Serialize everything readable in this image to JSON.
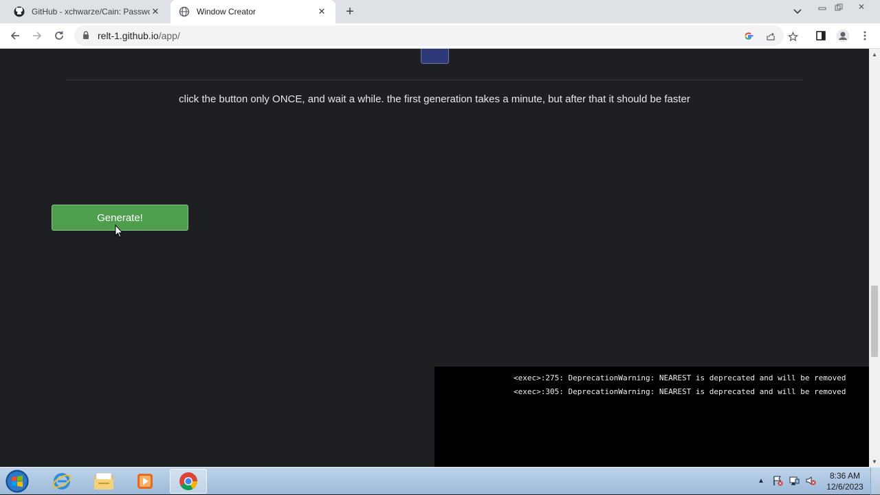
{
  "browser": {
    "tabs": [
      {
        "title": "GitHub - xchwarze/Cain: Passwor",
        "icon": "github-icon",
        "active": false
      },
      {
        "title": "Window Creator",
        "icon": "globe-icon",
        "active": true
      }
    ],
    "url_host": "relt-1.github.io",
    "url_path": "/app/"
  },
  "page": {
    "instructions": "click the button only ONCE, and wait a while. the first generation takes a minute, but after that it should be faster",
    "generate_label": "Generate!",
    "console_lines": [
      "<exec>:275: DeprecationWarning: NEAREST is deprecated and will be removed",
      "<exec>:305: DeprecationWarning: NEAREST is deprecated and will be removed"
    ],
    "colors": {
      "background": "#1e1f22",
      "button": "#4e9e4e",
      "console": "#000000",
      "preview": "#2e3a78"
    }
  },
  "taskbar": {
    "items": [
      "start-orb",
      "internet-explorer-icon",
      "file-explorer-icon",
      "media-player-icon",
      "chrome-icon"
    ],
    "time": "8:36 AM",
    "date": "12/6/2023"
  }
}
